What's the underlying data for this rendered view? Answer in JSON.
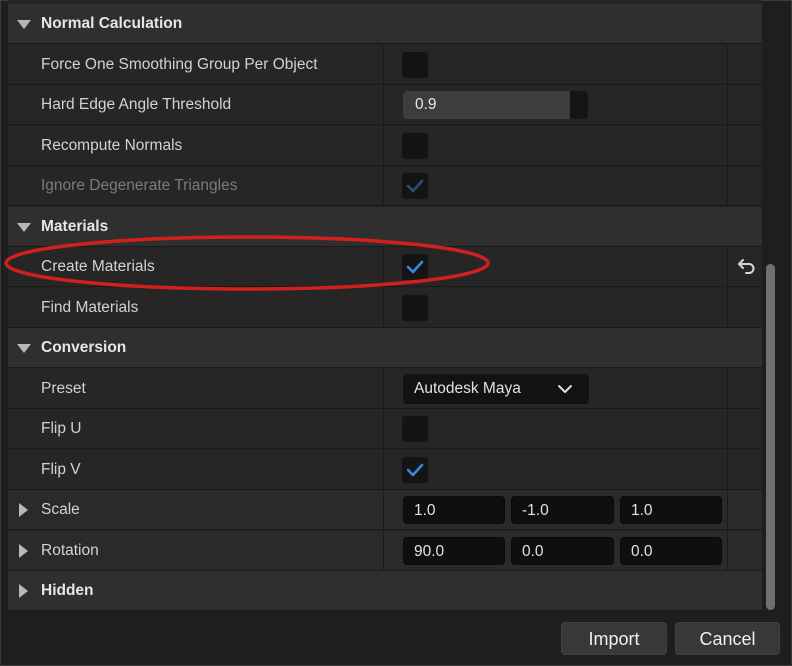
{
  "sections": {
    "normal_calculation": {
      "label": "Normal Calculation",
      "force_one_smoothing": {
        "label": "Force One Smoothing Group Per Object",
        "checked": false
      },
      "hard_edge_angle": {
        "label": "Hard Edge Angle Threshold",
        "value": "0.9",
        "fill_fraction": 0.9
      },
      "recompute_normals": {
        "label": "Recompute Normals",
        "checked": false
      },
      "ignore_degenerate": {
        "label": "Ignore Degenerate Triangles",
        "checked": true,
        "disabled": true
      }
    },
    "materials": {
      "label": "Materials",
      "create_materials": {
        "label": "Create Materials",
        "checked": true,
        "modified": true
      },
      "find_materials": {
        "label": "Find Materials",
        "checked": false
      }
    },
    "conversion": {
      "label": "Conversion",
      "preset": {
        "label": "Preset",
        "value": "Autodesk Maya"
      },
      "flip_u": {
        "label": "Flip U",
        "checked": false
      },
      "flip_v": {
        "label": "Flip V",
        "checked": true
      },
      "scale": {
        "label": "Scale",
        "values": [
          "1.0",
          "-1.0",
          "1.0"
        ]
      },
      "rotation": {
        "label": "Rotation",
        "values": [
          "90.0",
          "0.0",
          "0.0"
        ]
      }
    },
    "hidden": {
      "label": "Hidden"
    }
  },
  "buttons": {
    "import": "Import",
    "cancel": "Cancel"
  },
  "colors": {
    "accent_check": "#3a86e0",
    "annotation": "#d0201f"
  },
  "icons": [
    "chevron-down-icon",
    "expand-arrow-icon",
    "checkmark-icon",
    "reset-arrow-icon"
  ]
}
